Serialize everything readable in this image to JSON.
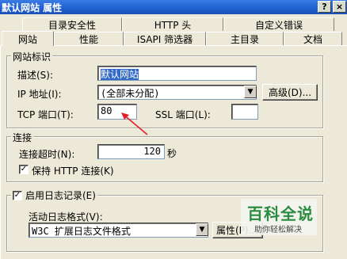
{
  "window": {
    "title": "默认网站  属性",
    "help": "?",
    "close": "×"
  },
  "tabs_row1": [
    "目录安全性",
    "HTTP 头",
    "自定义错误"
  ],
  "tabs_row2": [
    "网站",
    "性能",
    "ISAPI 筛选器",
    "主目录",
    "文档"
  ],
  "identity": {
    "group_label": "网站标识",
    "description_label": "描述(S):",
    "description_value": "默认网站",
    "ip_label": "IP 地址(I):",
    "ip_value": "(全部未分配)",
    "advanced_button": "高级(D)...",
    "tcp_label": "TCP 端口(T):",
    "tcp_value": "80",
    "ssl_label": "SSL 端口(L):",
    "ssl_value": ""
  },
  "connections": {
    "group_label": "连接",
    "timeout_label": "连接超时(N):",
    "timeout_value": "120",
    "timeout_unit": "秒",
    "keepalive_checked": true,
    "keepalive_label": "保持 HTTP 连接(K)"
  },
  "logging": {
    "enable_checked": true,
    "enable_label": "启用日志记录(E)",
    "format_label": "活动日志格式(V):",
    "format_value": "W3C 扩展日志文件格式",
    "properties_button": "属性(P)..."
  },
  "watermark": {
    "title": "百科全说",
    "subtitle": "助你轻松解决"
  },
  "colors": {
    "titlebar": "#1f5fcf",
    "arrow": "#e0202a",
    "selection": "#316ac5",
    "watermark": "#2a8c3e"
  }
}
